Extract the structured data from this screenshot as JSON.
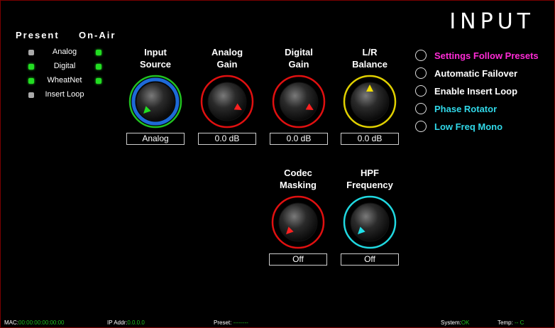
{
  "title": "INPUT",
  "headers": {
    "present": "Present",
    "on_air": "On-Air"
  },
  "sources": [
    {
      "label": "Analog",
      "present": "gray",
      "on_air": "green"
    },
    {
      "label": "Digital",
      "present": "green",
      "on_air": "green"
    },
    {
      "label": "WheatNet",
      "present": "green",
      "on_air": "green"
    },
    {
      "label": "Insert Loop",
      "present": "gray",
      "on_air": "none"
    }
  ],
  "knobs": [
    {
      "label1": "Input",
      "label2": "Source",
      "value": "Analog",
      "ring": "#21c021",
      "inner_ring": "#1e6ad8",
      "indicator": "#22dd22",
      "angle": 225
    },
    {
      "label1": "Analog",
      "label2": "Gain",
      "value": "0.0 dB",
      "ring": "#e01010",
      "inner_ring": "",
      "indicator": "#ff2020",
      "angle": 120
    },
    {
      "label1": "Digital",
      "label2": "Gain",
      "value": "0.0 dB",
      "ring": "#e01010",
      "inner_ring": "",
      "indicator": "#ff2020",
      "angle": 120
    },
    {
      "label1": "L/R",
      "label2": "Balance",
      "value": "0.0 dB",
      "ring": "#e0d000",
      "inner_ring": "",
      "indicator": "#f5e000",
      "angle": 0
    },
    {
      "label1": "Codec",
      "label2": "Masking",
      "value": "Off",
      "ring": "#e01010",
      "inner_ring": "",
      "indicator": "#ff2020",
      "angle": 225
    },
    {
      "label1": "HPF",
      "label2": "Frequency",
      "value": "Off",
      "ring": "#20d8e0",
      "inner_ring": "",
      "indicator": "#20e0e8",
      "angle": 225
    }
  ],
  "options": [
    {
      "label": "Settings Follow Presets",
      "color": "#ff2bd6"
    },
    {
      "label": "Automatic Failover",
      "color": "#ffffff"
    },
    {
      "label": "Enable Insert Loop",
      "color": "#ffffff"
    },
    {
      "label": "Phase Rotator",
      "color": "#30d8e8"
    },
    {
      "label": "Low Freq Mono",
      "color": "#30d8e8"
    }
  ],
  "status": {
    "mac_label": "MAC:",
    "mac_value": "00:00:00:00:00:00",
    "ip_label": "IP Addr:",
    "ip_value": "0.0.0.0",
    "preset_label": "Preset:",
    "preset_value": "--------",
    "system_label": "System:",
    "system_value": "OK",
    "temp_label": "Temp:",
    "temp_value": "-- C"
  }
}
